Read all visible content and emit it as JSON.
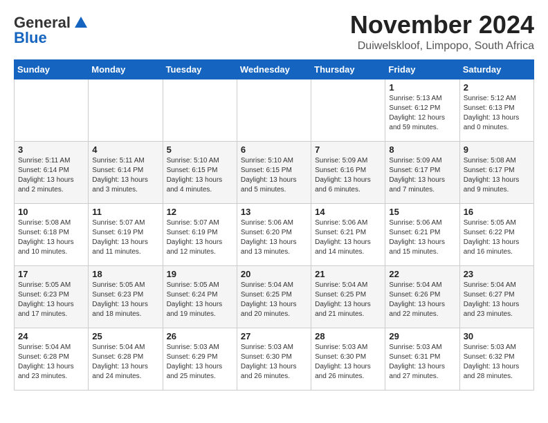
{
  "logo": {
    "general": "General",
    "blue": "Blue"
  },
  "title": "November 2024",
  "location": "Duiwelskloof, Limpopo, South Africa",
  "header": {
    "days": [
      "Sunday",
      "Monday",
      "Tuesday",
      "Wednesday",
      "Thursday",
      "Friday",
      "Saturday"
    ]
  },
  "weeks": [
    [
      {
        "day": "",
        "info": ""
      },
      {
        "day": "",
        "info": ""
      },
      {
        "day": "",
        "info": ""
      },
      {
        "day": "",
        "info": ""
      },
      {
        "day": "",
        "info": ""
      },
      {
        "day": "1",
        "info": "Sunrise: 5:13 AM\nSunset: 6:12 PM\nDaylight: 12 hours\nand 59 minutes."
      },
      {
        "day": "2",
        "info": "Sunrise: 5:12 AM\nSunset: 6:13 PM\nDaylight: 13 hours\nand 0 minutes."
      }
    ],
    [
      {
        "day": "3",
        "info": "Sunrise: 5:11 AM\nSunset: 6:14 PM\nDaylight: 13 hours\nand 2 minutes."
      },
      {
        "day": "4",
        "info": "Sunrise: 5:11 AM\nSunset: 6:14 PM\nDaylight: 13 hours\nand 3 minutes."
      },
      {
        "day": "5",
        "info": "Sunrise: 5:10 AM\nSunset: 6:15 PM\nDaylight: 13 hours\nand 4 minutes."
      },
      {
        "day": "6",
        "info": "Sunrise: 5:10 AM\nSunset: 6:15 PM\nDaylight: 13 hours\nand 5 minutes."
      },
      {
        "day": "7",
        "info": "Sunrise: 5:09 AM\nSunset: 6:16 PM\nDaylight: 13 hours\nand 6 minutes."
      },
      {
        "day": "8",
        "info": "Sunrise: 5:09 AM\nSunset: 6:17 PM\nDaylight: 13 hours\nand 7 minutes."
      },
      {
        "day": "9",
        "info": "Sunrise: 5:08 AM\nSunset: 6:17 PM\nDaylight: 13 hours\nand 9 minutes."
      }
    ],
    [
      {
        "day": "10",
        "info": "Sunrise: 5:08 AM\nSunset: 6:18 PM\nDaylight: 13 hours\nand 10 minutes."
      },
      {
        "day": "11",
        "info": "Sunrise: 5:07 AM\nSunset: 6:19 PM\nDaylight: 13 hours\nand 11 minutes."
      },
      {
        "day": "12",
        "info": "Sunrise: 5:07 AM\nSunset: 6:19 PM\nDaylight: 13 hours\nand 12 minutes."
      },
      {
        "day": "13",
        "info": "Sunrise: 5:06 AM\nSunset: 6:20 PM\nDaylight: 13 hours\nand 13 minutes."
      },
      {
        "day": "14",
        "info": "Sunrise: 5:06 AM\nSunset: 6:21 PM\nDaylight: 13 hours\nand 14 minutes."
      },
      {
        "day": "15",
        "info": "Sunrise: 5:06 AM\nSunset: 6:21 PM\nDaylight: 13 hours\nand 15 minutes."
      },
      {
        "day": "16",
        "info": "Sunrise: 5:05 AM\nSunset: 6:22 PM\nDaylight: 13 hours\nand 16 minutes."
      }
    ],
    [
      {
        "day": "17",
        "info": "Sunrise: 5:05 AM\nSunset: 6:23 PM\nDaylight: 13 hours\nand 17 minutes."
      },
      {
        "day": "18",
        "info": "Sunrise: 5:05 AM\nSunset: 6:23 PM\nDaylight: 13 hours\nand 18 minutes."
      },
      {
        "day": "19",
        "info": "Sunrise: 5:05 AM\nSunset: 6:24 PM\nDaylight: 13 hours\nand 19 minutes."
      },
      {
        "day": "20",
        "info": "Sunrise: 5:04 AM\nSunset: 6:25 PM\nDaylight: 13 hours\nand 20 minutes."
      },
      {
        "day": "21",
        "info": "Sunrise: 5:04 AM\nSunset: 6:25 PM\nDaylight: 13 hours\nand 21 minutes."
      },
      {
        "day": "22",
        "info": "Sunrise: 5:04 AM\nSunset: 6:26 PM\nDaylight: 13 hours\nand 22 minutes."
      },
      {
        "day": "23",
        "info": "Sunrise: 5:04 AM\nSunset: 6:27 PM\nDaylight: 13 hours\nand 23 minutes."
      }
    ],
    [
      {
        "day": "24",
        "info": "Sunrise: 5:04 AM\nSunset: 6:28 PM\nDaylight: 13 hours\nand 23 minutes."
      },
      {
        "day": "25",
        "info": "Sunrise: 5:04 AM\nSunset: 6:28 PM\nDaylight: 13 hours\nand 24 minutes."
      },
      {
        "day": "26",
        "info": "Sunrise: 5:03 AM\nSunset: 6:29 PM\nDaylight: 13 hours\nand 25 minutes."
      },
      {
        "day": "27",
        "info": "Sunrise: 5:03 AM\nSunset: 6:30 PM\nDaylight: 13 hours\nand 26 minutes."
      },
      {
        "day": "28",
        "info": "Sunrise: 5:03 AM\nSunset: 6:30 PM\nDaylight: 13 hours\nand 26 minutes."
      },
      {
        "day": "29",
        "info": "Sunrise: 5:03 AM\nSunset: 6:31 PM\nDaylight: 13 hours\nand 27 minutes."
      },
      {
        "day": "30",
        "info": "Sunrise: 5:03 AM\nSunset: 6:32 PM\nDaylight: 13 hours\nand 28 minutes."
      }
    ]
  ]
}
